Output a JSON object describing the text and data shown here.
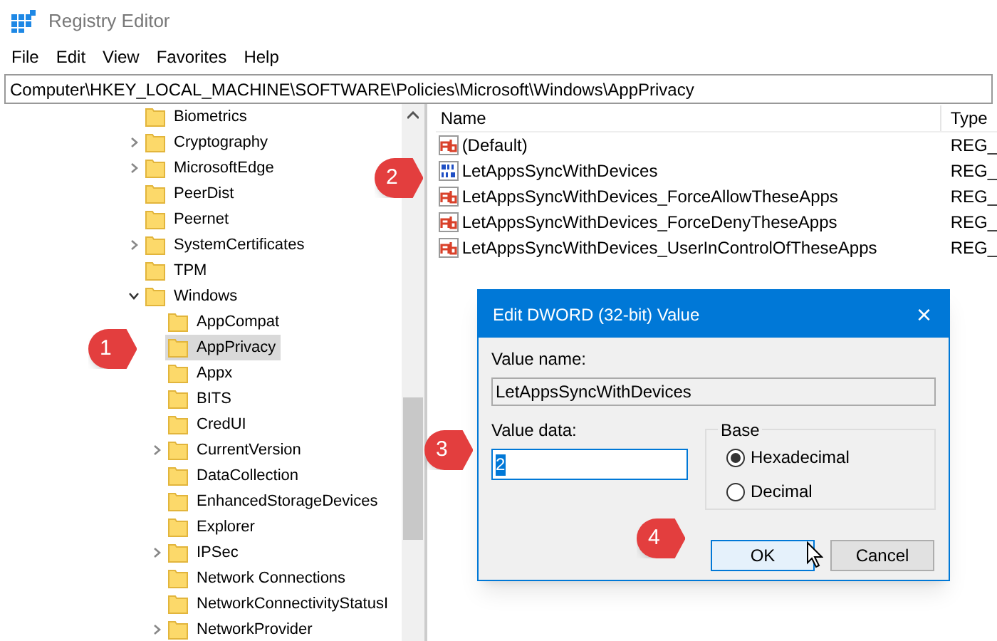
{
  "window": {
    "title": "Registry Editor"
  },
  "menu": [
    "File",
    "Edit",
    "View",
    "Favorites",
    "Help"
  ],
  "address": "Computer\\HKEY_LOCAL_MACHINE\\SOFTWARE\\Policies\\Microsoft\\Windows\\AppPrivacy",
  "tree": [
    {
      "label": "Biometrics",
      "has_children": false,
      "selected": false
    },
    {
      "label": "Cryptography",
      "has_children": true,
      "selected": false
    },
    {
      "label": "MicrosoftEdge",
      "has_children": true,
      "selected": false
    },
    {
      "label": "PeerDist",
      "has_children": false,
      "selected": false
    },
    {
      "label": "Peernet",
      "has_children": false,
      "selected": false
    },
    {
      "label": "SystemCertificates",
      "has_children": true,
      "selected": false
    },
    {
      "label": "TPM",
      "has_children": false,
      "selected": false
    },
    {
      "label": "Windows",
      "has_children": true,
      "expanded": true,
      "selected": false,
      "children": [
        {
          "label": "AppCompat",
          "has_children": false,
          "selected": false
        },
        {
          "label": "AppPrivacy",
          "has_children": false,
          "selected": true
        },
        {
          "label": "Appx",
          "has_children": false,
          "selected": false
        },
        {
          "label": "BITS",
          "has_children": false,
          "selected": false
        },
        {
          "label": "CredUI",
          "has_children": false,
          "selected": false
        },
        {
          "label": "CurrentVersion",
          "has_children": true,
          "selected": false
        },
        {
          "label": "DataCollection",
          "has_children": false,
          "selected": false
        },
        {
          "label": "EnhancedStorageDevices",
          "has_children": false,
          "selected": false
        },
        {
          "label": "Explorer",
          "has_children": false,
          "selected": false
        },
        {
          "label": "IPSec",
          "has_children": true,
          "selected": false
        },
        {
          "label": "Network Connections",
          "has_children": false,
          "selected": false
        },
        {
          "label": "NetworkConnectivityStatusI",
          "has_children": false,
          "selected": false
        },
        {
          "label": "NetworkProvider",
          "has_children": true,
          "selected": false
        }
      ]
    }
  ],
  "values": {
    "columns": [
      "Name",
      "Type"
    ],
    "rows": [
      {
        "kind": "string",
        "name": "(Default)",
        "type": "REG_"
      },
      {
        "kind": "dword",
        "name": "LetAppsSyncWithDevices",
        "type": "REG_"
      },
      {
        "kind": "string",
        "name": "LetAppsSyncWithDevices_ForceAllowTheseApps",
        "type": "REG_"
      },
      {
        "kind": "string",
        "name": "LetAppsSyncWithDevices_ForceDenyTheseApps",
        "type": "REG_"
      },
      {
        "kind": "string",
        "name": "LetAppsSyncWithDevices_UserInControlOfTheseApps",
        "type": "REG_"
      }
    ]
  },
  "dialog": {
    "title": "Edit DWORD (32-bit) Value",
    "close": "×",
    "value_name_label": "Value name:",
    "value_name": "LetAppsSyncWithDevices",
    "value_data_label": "Value data:",
    "value_data": "2",
    "base_label": "Base",
    "radios": [
      {
        "label": "Hexadecimal",
        "selected": true
      },
      {
        "label": "Decimal",
        "selected": false
      }
    ],
    "buttons": [
      {
        "label": "OK",
        "kind": "default"
      },
      {
        "label": "Cancel",
        "kind": "normal"
      }
    ]
  },
  "callouts": [
    "1",
    "2",
    "3",
    "4"
  ]
}
